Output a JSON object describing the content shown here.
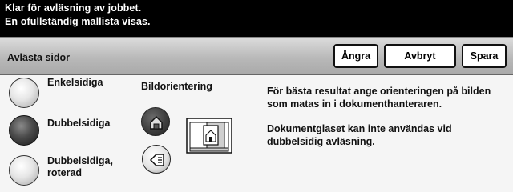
{
  "status": {
    "line1": "Klar för avläsning av jobbet.",
    "line2": "En ofullständig mallista visas."
  },
  "header": {
    "title": "Avlästa sidor",
    "buttons": {
      "undo": "Ångra",
      "cancel": "Avbryt",
      "save": "Spara"
    }
  },
  "sides": {
    "options": [
      {
        "label": "Enkelsidiga",
        "selected": false
      },
      {
        "label": "Dubbelsidiga",
        "selected": true
      },
      {
        "label_line1": "Dubbelsidiga,",
        "label_line2": "roterad",
        "selected": false
      }
    ]
  },
  "orientation": {
    "title": "Bildorientering",
    "options": [
      {
        "icon": "upright-image-icon",
        "selected": true
      },
      {
        "icon": "sideways-image-icon",
        "selected": false
      }
    ]
  },
  "info": {
    "para1_line1": "För bästa resultat ange orienteringen på bilden",
    "para1_line2": "som matas in i dokumenthanteraren.",
    "para2_line1": "Dokumentglaset kan inte användas vid",
    "para2_line2": "dubbelsidig avläsning."
  },
  "colors": {
    "status_bg": "#000000",
    "header_bg": "#b9b9b9",
    "selected": "#333333"
  }
}
